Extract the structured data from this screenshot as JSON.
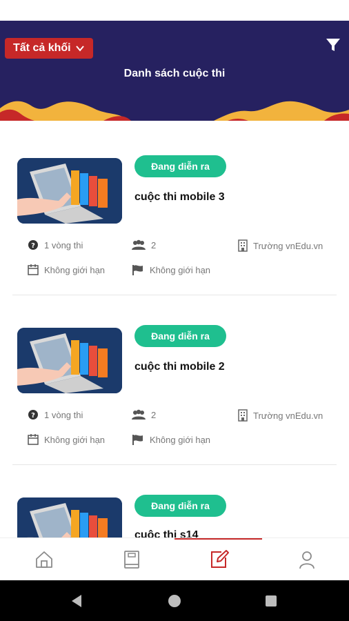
{
  "header": {
    "grade_select": "Tất cả khối",
    "title": "Danh sách cuộc thi",
    "colors": {
      "background": "#262160",
      "select": "#c62828",
      "wave_yellow": "#f2b33d",
      "wave_red": "#c62828"
    }
  },
  "contests": [
    {
      "status": "Đang diễn ra",
      "name": "cuộc thi mobile 3",
      "rounds": "1 vòng thi",
      "participants": "2",
      "organizer": "Trường vnEdu.vn",
      "time_limit": "Không giới hạn",
      "attempt_limit": "Không giới hạn"
    },
    {
      "status": "Đang diễn ra",
      "name": "cuộc thi mobile 2",
      "rounds": "1 vòng thi",
      "participants": "2",
      "organizer": "Trường vnEdu.vn",
      "time_limit": "Không giới hạn",
      "attempt_limit": "Không giới hạn"
    },
    {
      "status": "Đang diễn ra",
      "name": "cuộc thi s14"
    }
  ],
  "bottom_nav": [
    {
      "icon": "home-icon",
      "active": false
    },
    {
      "icon": "book-icon",
      "active": false
    },
    {
      "icon": "edit-icon",
      "active": true
    },
    {
      "icon": "user-icon",
      "active": false
    }
  ],
  "colors": {
    "badge": "#1fbf8f",
    "active": "#c62828",
    "nav_inactive": "#8a8a8a"
  }
}
